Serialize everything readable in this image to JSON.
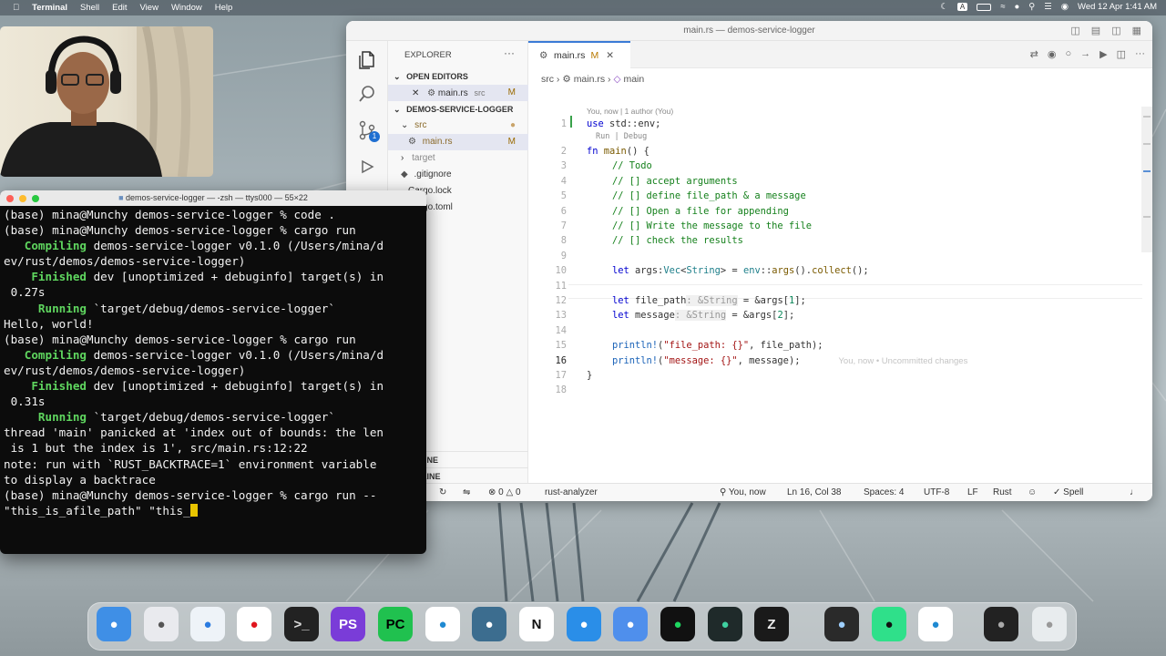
{
  "menubar": {
    "app": "Terminal",
    "items": [
      "Shell",
      "Edit",
      "View",
      "Window",
      "Help"
    ],
    "clock": "Wed 12 Apr  1:41 AM",
    "input": "A"
  },
  "vscode": {
    "title": "main.rs — demos-service-logger",
    "explorer": {
      "header": "EXPLORER",
      "open_editors": "OPEN EDITORS",
      "open_file": "main.rs",
      "open_file_dir": "src",
      "open_file_badge": "M",
      "project": "DEMOS-SERVICE-LOGGER",
      "tree": [
        {
          "label": "src",
          "badge": ""
        },
        {
          "label": "main.rs",
          "badge": "M"
        },
        {
          "label": "target",
          "badge": ""
        },
        {
          "label": ".gitignore",
          "badge": ""
        },
        {
          "label": "Cargo.lock",
          "badge": ""
        },
        {
          "label": "Cargo.toml",
          "badge": ""
        }
      ],
      "outline": "OUTLINE",
      "timeline": "TIMELINE"
    },
    "tab": {
      "label": "main.rs",
      "badge": "M"
    },
    "breadcrumb": [
      "src",
      "main.rs",
      "main"
    ],
    "blame": "You, now | 1 author (You)",
    "run_lens": "Run | Debug",
    "source_control_badge": "1",
    "code": {
      "l1": {
        "kw": "use",
        "rest": " std::env;"
      },
      "l2": {
        "kw": "fn",
        "name": "main",
        "rest": "() {"
      },
      "l3": "// Todo",
      "l4": "// [] accept arguments",
      "l5": "// [] define file_path & a message",
      "l6": "// [] Open a file for appending",
      "l7": "// [] Write the message to the file",
      "l8": "// [] check the results",
      "l10": {
        "kw": "let",
        "a": " args:",
        "ty1": "Vec",
        "b": "<",
        "ty2": "String",
        "c": "> = ",
        "fn1": "env",
        "d": "::",
        "fn2": "args",
        "e": "().",
        "fn3": "collect",
        "f": "();"
      },
      "l12": {
        "kw": "let",
        "a": " file_path",
        "hint": ": &String",
        "b": " = &args[",
        "n": "1",
        "c": "];"
      },
      "l13": {
        "kw": "let",
        "a": " message",
        "hint": ": &String",
        "b": " = &args[",
        "n": "2",
        "c": "];"
      },
      "l15": {
        "mac": "println!",
        "a": "(",
        "s": "\"file_path: {}\"",
        "b": ", file_path);"
      },
      "l16": {
        "mac": "println!",
        "a": "(",
        "s": "\"message: {}\"",
        "b": ", message);",
        "ghost": "You, now • Uncommitted changes"
      },
      "l17": "}"
    },
    "status": {
      "errors": "0",
      "warnings": "0",
      "lsp": "rust-analyzer",
      "blame": "You, now",
      "position": "Ln 16, Col 38",
      "spaces": "Spaces: 4",
      "encoding": "UTF-8",
      "eol": "LF",
      "language": "Rust",
      "spell": "Spell"
    }
  },
  "terminal": {
    "title": "demos-service-logger — -zsh — ttys000 — 55×22",
    "lines": [
      {
        "text": "(base) mina@Munchy demos-service-logger % code ."
      },
      {
        "text": "(base) mina@Munchy demos-service-logger % cargo run"
      },
      {
        "g": "   Compiling",
        "text": " demos-service-logger v0.1.0 (/Users/mina/d"
      },
      {
        "text": "ev/rust/demos/demos-service-logger)"
      },
      {
        "g": "    Finished",
        "text": " dev [unoptimized + debuginfo] target(s) in"
      },
      {
        "text": " 0.27s"
      },
      {
        "g": "     Running",
        "text": " `target/debug/demos-service-logger`"
      },
      {
        "text": "Hello, world!"
      },
      {
        "text": "(base) mina@Munchy demos-service-logger % cargo run"
      },
      {
        "g": "   Compiling",
        "text": " demos-service-logger v0.1.0 (/Users/mina/d"
      },
      {
        "text": "ev/rust/demos/demos-service-logger)"
      },
      {
        "g": "    Finished",
        "text": " dev [unoptimized + debuginfo] target(s) in"
      },
      {
        "text": " 0.31s"
      },
      {
        "g": "     Running",
        "text": " `target/debug/demos-service-logger`"
      },
      {
        "text": "thread 'main' panicked at 'index out of bounds: the len"
      },
      {
        "text": " is 1 but the index is 1', src/main.rs:12:22"
      },
      {
        "text": "note: run with `RUST_BACKTRACE=1` environment variable"
      },
      {
        "text": "to display a backtrace"
      },
      {
        "text": "(base) mina@Munchy demos-service-logger % cargo run --"
      },
      {
        "text": "\"this_is_afile_path\" \"this_"
      }
    ]
  },
  "dock": {
    "apps": [
      {
        "icon": "finder-icon",
        "label": "",
        "bg": "#3f8fe6",
        "fg": "#fff"
      },
      {
        "icon": "launchpad-icon",
        "label": "",
        "bg": "#e9eaee",
        "fg": "#555"
      },
      {
        "icon": "safari-icon",
        "label": "",
        "bg": "#eef3f8",
        "fg": "#2a7be0"
      },
      {
        "icon": "opera-icon",
        "label": "",
        "bg": "#ffffff",
        "fg": "#e0151e"
      },
      {
        "icon": "terminal-icon",
        "label": ">_",
        "bg": "#222",
        "fg": "#ddd"
      },
      {
        "icon": "phpstorm-icon",
        "label": "PS",
        "bg": "#7a3cd8",
        "fg": "#fff"
      },
      {
        "icon": "pycharm-icon",
        "label": "PC",
        "bg": "#20c14f",
        "fg": "#000"
      },
      {
        "icon": "vscode-icon",
        "label": "",
        "bg": "#ffffff",
        "fg": "#1f8ad2"
      },
      {
        "icon": "mysql-workbench-icon",
        "label": "",
        "bg": "#3c6d8f",
        "fg": "#fff"
      },
      {
        "icon": "notion-icon",
        "label": "N",
        "bg": "#ffffff",
        "fg": "#111"
      },
      {
        "icon": "docker-icon",
        "label": "",
        "bg": "#2a8ee8",
        "fg": "#fff"
      },
      {
        "icon": "arc-icon",
        "label": "",
        "bg": "#4f8fec",
        "fg": "#fff"
      },
      {
        "icon": "spotify-icon",
        "label": "",
        "bg": "#111",
        "fg": "#1ed760"
      },
      {
        "icon": "lab-icon",
        "label": "",
        "bg": "#1f2a2a",
        "fg": "#3fd0a0"
      },
      {
        "icon": "zed-icon",
        "label": "Z",
        "bg": "#1a1a1a",
        "fg": "#eee"
      },
      {
        "icon": "quicktime-icon",
        "label": "",
        "bg": "#2a2a2a",
        "fg": "#9fd0ff"
      },
      {
        "icon": "copilot-icon",
        "label": "",
        "bg": "#2fe08a",
        "fg": "#111"
      },
      {
        "icon": "vscode-insiders-icon",
        "label": "",
        "bg": "#ffffff",
        "fg": "#1f8ad2"
      },
      {
        "icon": "terminal-window-icon",
        "label": "",
        "bg": "#222",
        "fg": "#aaa"
      },
      {
        "icon": "trash-icon",
        "label": "",
        "bg": "#e8ecee",
        "fg": "#999"
      }
    ]
  }
}
